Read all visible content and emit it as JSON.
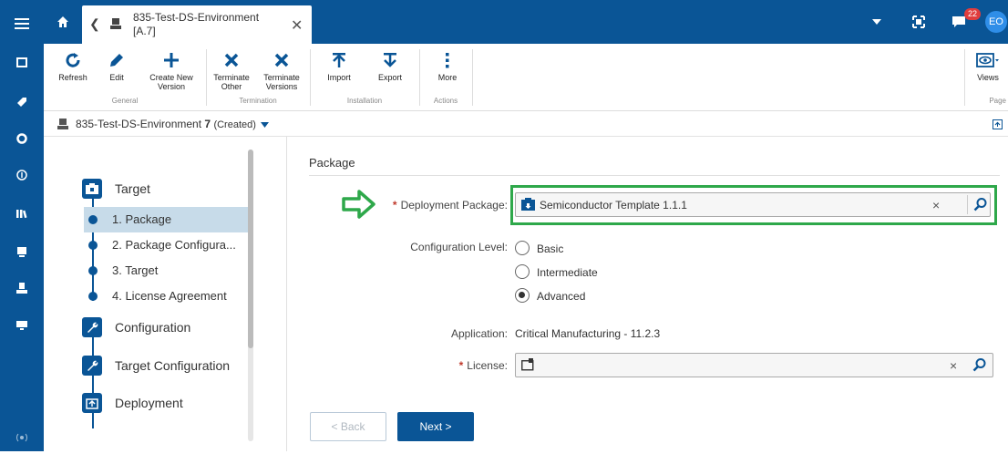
{
  "sidebar": {
    "items": [
      "menu-icon",
      "clipboard-icon",
      "tag-icon",
      "circle-icon",
      "info-icon",
      "library-icon",
      "monitor-icon",
      "printer-icon",
      "display-icon",
      "signal-icon"
    ]
  },
  "topbar": {
    "tab_title": "835-Test-DS-Environment [A.7]",
    "notification_count": "22",
    "avatar": "EO"
  },
  "ribbon": {
    "refresh": "Refresh",
    "edit": "Edit",
    "create_new_version": "Create New Version",
    "terminate_other": "Terminate Other",
    "terminate_versions": "Terminate Versions",
    "import": "Import",
    "export": "Export",
    "more": "More",
    "views": "Views",
    "groups": {
      "general": "General",
      "termination": "Termination",
      "installation": "Installation",
      "actions": "Actions",
      "page": "Page"
    }
  },
  "breadcrumb": {
    "name": "835-Test-DS-Environment",
    "version": "7",
    "state": "(Created)"
  },
  "wizard": {
    "steps": [
      {
        "label": "Target"
      },
      {
        "label": "Configuration"
      },
      {
        "label": "Target Configuration"
      },
      {
        "label": "Deployment"
      }
    ],
    "substeps": [
      {
        "label": "1. Package"
      },
      {
        "label": "2. Package Configura..."
      },
      {
        "label": "3. Target"
      },
      {
        "label": "4. License Agreement"
      }
    ]
  },
  "form": {
    "section_title": "Package",
    "deployment_package_label": "Deployment Package:",
    "deployment_package_value": "Semiconductor Template 1.1.1",
    "configuration_level_label": "Configuration Level:",
    "levels": [
      "Basic",
      "Intermediate",
      "Advanced"
    ],
    "selected_level": "Advanced",
    "application_label": "Application:",
    "application_value": "Critical Manufacturing - 11.2.3",
    "license_label": "License:",
    "license_value": "",
    "clear_symbol": "×"
  },
  "buttons": {
    "back": "< Back",
    "next": "Next >"
  },
  "colors": {
    "brand": "#0a5596",
    "highlight": "#2ea84a",
    "badge": "#e03d3d"
  }
}
